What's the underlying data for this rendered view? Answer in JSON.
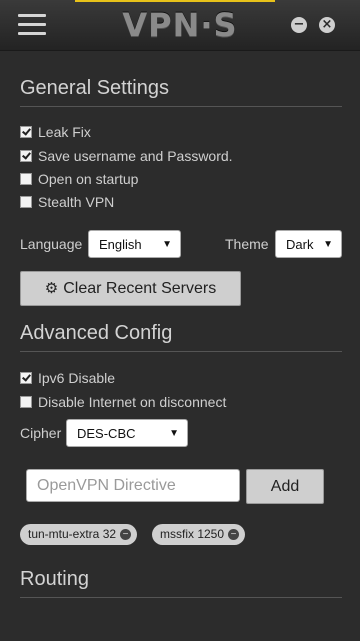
{
  "app": {
    "title": "VPN·S",
    "menu_icon": "hamburger-menu-icon",
    "accent_color": "#e8c21a"
  },
  "window_controls": {
    "minimize": "−",
    "close": "×"
  },
  "general": {
    "title": "General Settings",
    "options": [
      {
        "label": "Leak Fix",
        "checked": true
      },
      {
        "label": "Save username and Password.",
        "checked": true
      },
      {
        "label": "Open on startup",
        "checked": false
      },
      {
        "label": "Stealth VPN",
        "checked": false
      }
    ],
    "language_label": "Language",
    "language_value": "English",
    "theme_label": "Theme",
    "theme_value": "Dark",
    "clear_button": "Clear Recent Servers"
  },
  "advanced": {
    "title": "Advanced Config",
    "options": [
      {
        "label": "Ipv6 Disable",
        "checked": true
      },
      {
        "label": "Disable Internet on disconnect",
        "checked": false
      }
    ],
    "cipher_label": "Cipher",
    "cipher_value": "DES-CBC",
    "directive_placeholder": "OpenVPN Directive",
    "directive_value": "",
    "add_button": "Add",
    "tags": [
      "tun-mtu-extra 32",
      "mssfix 1250"
    ]
  },
  "routing": {
    "title": "Routing"
  }
}
